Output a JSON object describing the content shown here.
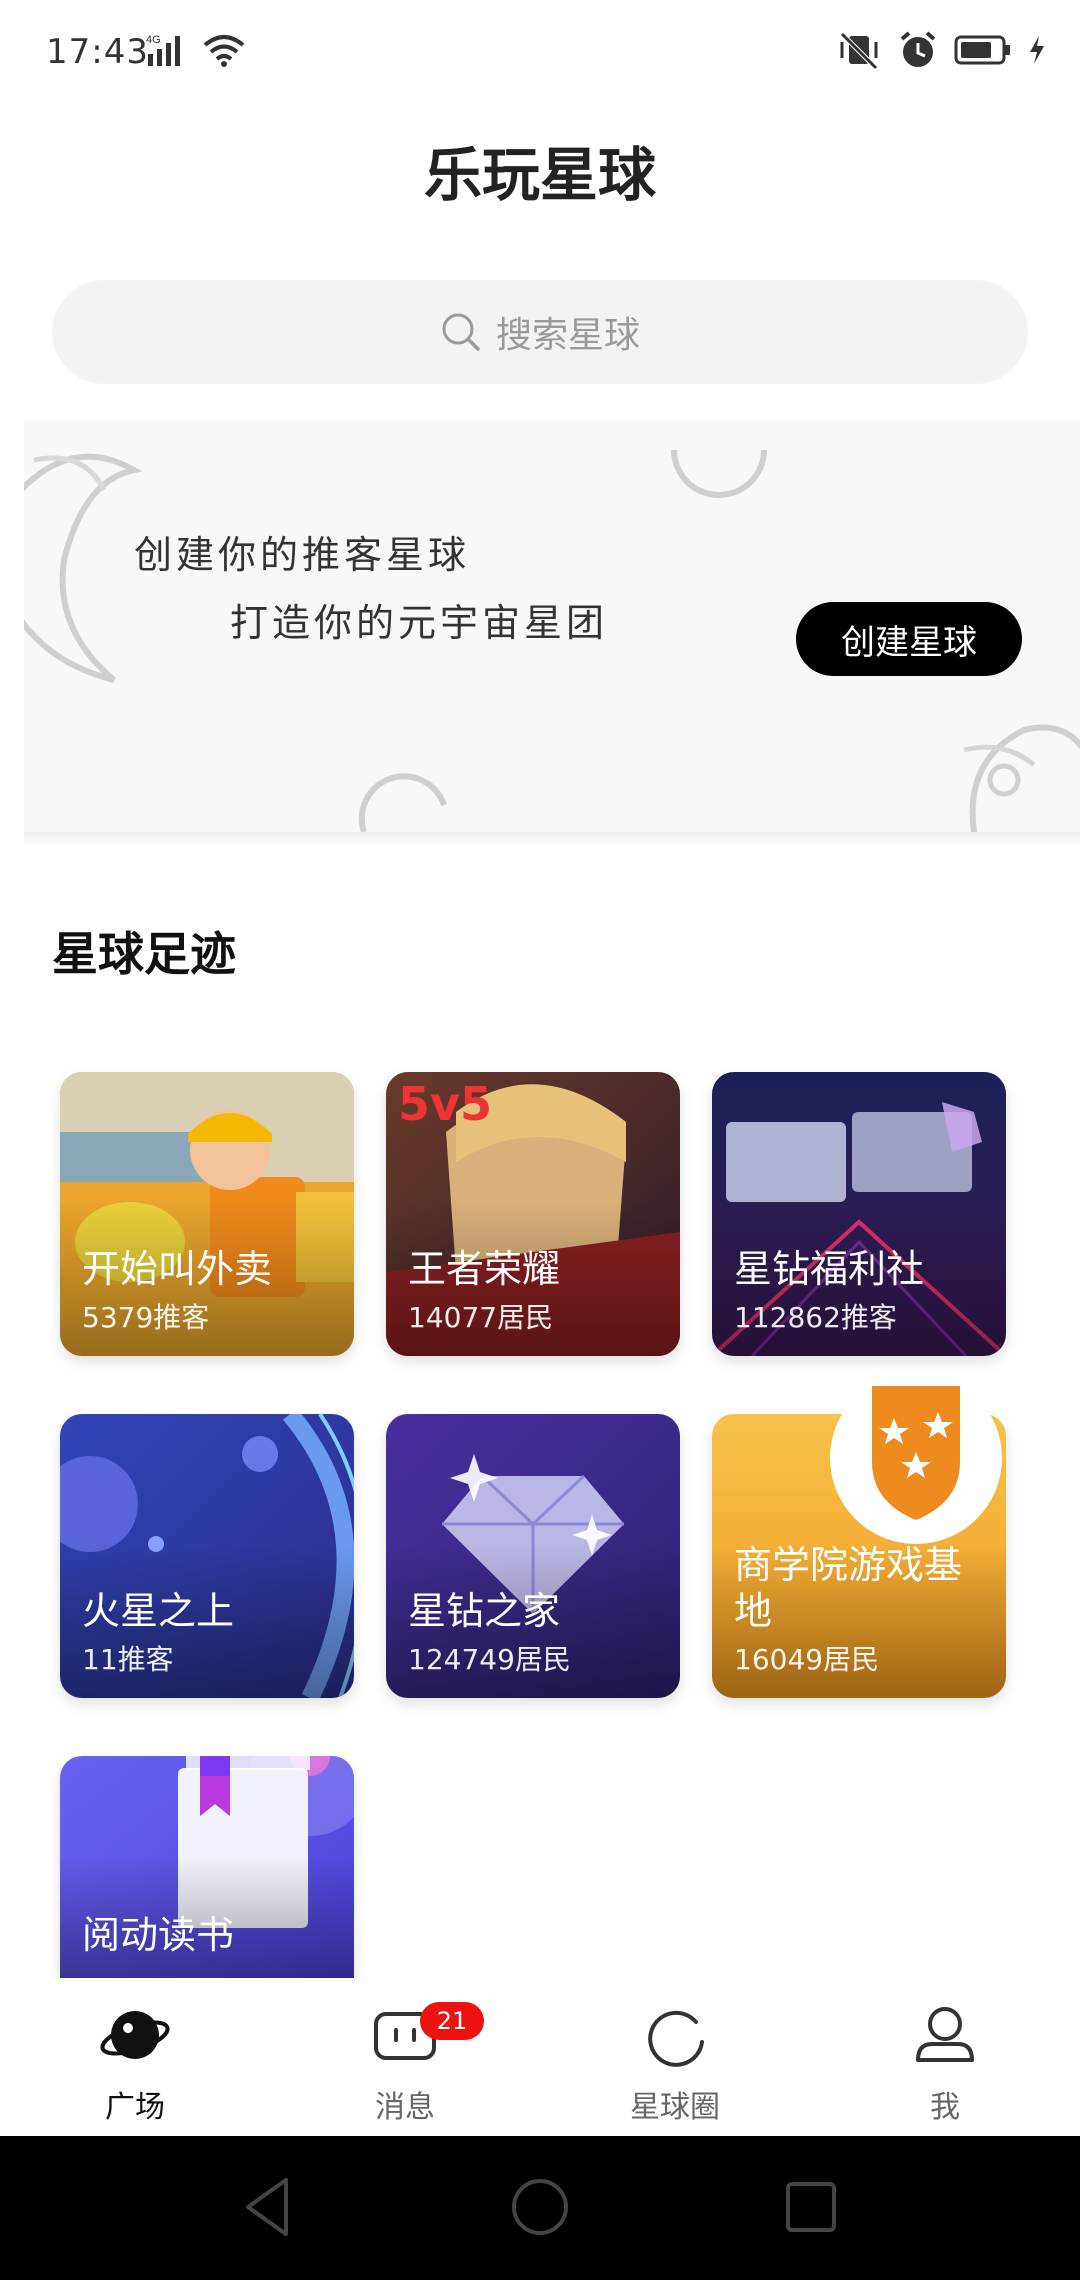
{
  "status_bar": {
    "time": "17:43",
    "network": "4G"
  },
  "header": {
    "title": "乐玩星球"
  },
  "search": {
    "placeholder": "搜索星球"
  },
  "banner": {
    "line1": "创建你的推客星球",
    "line2": "打造你的元宇宙星团",
    "button_label": "创建星球"
  },
  "section": {
    "title": "星球足迹"
  },
  "planets": [
    {
      "name": "开始叫外卖",
      "count": "5379推客",
      "icon": "delivery-rider"
    },
    {
      "name": "王者荣耀",
      "count": "14077居民",
      "icon": "game-hero"
    },
    {
      "name": "星钻福利社",
      "count": "112862推客",
      "icon": "star-diamond-welfare"
    },
    {
      "name": "火星之上",
      "count": "11推客",
      "icon": "planets-space"
    },
    {
      "name": "星钻之家",
      "count": "124749居民",
      "icon": "diamond"
    },
    {
      "name": "商学院游戏基地",
      "count": "16049居民",
      "icon": "shield-stars"
    },
    {
      "name": "阅动读书",
      "count": "",
      "icon": "book-bookmark"
    }
  ],
  "bottom_nav": {
    "items": [
      {
        "label": "广场",
        "icon": "planet-icon",
        "active": true
      },
      {
        "label": "消息",
        "icon": "message-icon",
        "active": false
      },
      {
        "label": "星球圈",
        "icon": "circle-icon",
        "active": false
      },
      {
        "label": "我",
        "icon": "user-icon",
        "active": false
      }
    ],
    "message_badge": "21"
  },
  "colors": {
    "accent": "#000000",
    "badge": "#ee1111",
    "search_bg": "#f3f3f3"
  }
}
